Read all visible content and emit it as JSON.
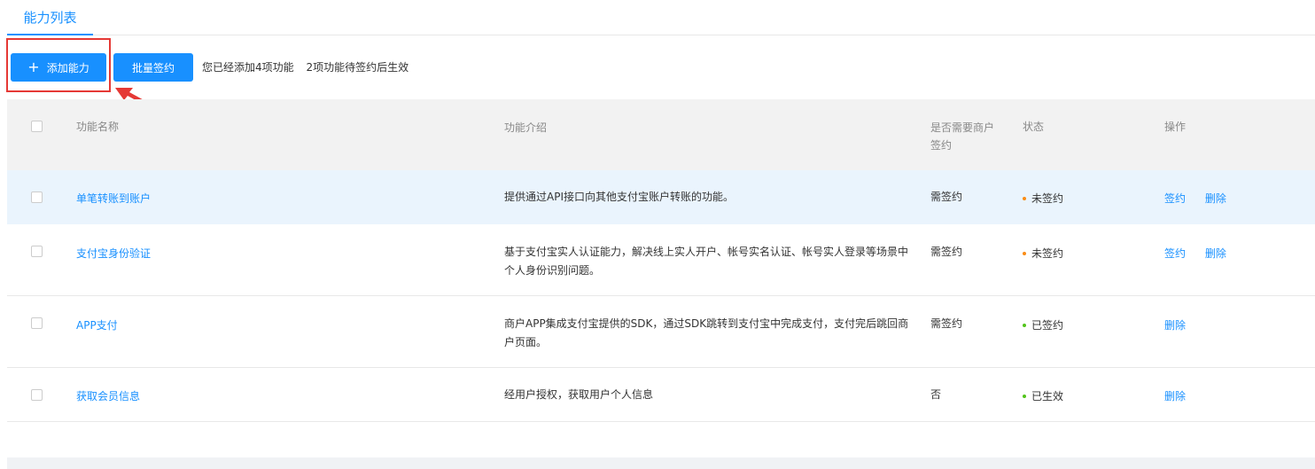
{
  "tab": {
    "label": "能力列表"
  },
  "toolbar": {
    "add_label": "添加能力",
    "add_icon": "plus-icon",
    "batch_label": "批量签约",
    "info_added": "您已经添加4项功能",
    "info_pending": "2项功能待签约后生效"
  },
  "table": {
    "headers": {
      "name": "功能名称",
      "desc": "功能介绍",
      "need_sign_line1": "是否需要商户",
      "need_sign_line2": "签约",
      "status": "状态",
      "ops": "操作"
    },
    "rows": [
      {
        "name": "单笔转账到账户",
        "desc": "提供通过API接口向其他支付宝账户转账的功能。",
        "need": "需签约",
        "status": "未签约",
        "status_color": "#fa8c16",
        "sign": "签约",
        "delete": "删除"
      },
      {
        "name": "支付宝身份验证",
        "desc": "基于支付宝实人认证能力，解决线上实人开户、帐号实名认证、帐号实人登录等场景中个人身份识别问题。",
        "need": "需签约",
        "status": "未签约",
        "status_color": "#fa8c16",
        "sign": "签约",
        "delete": "删除"
      },
      {
        "name": "APP支付",
        "desc": "商户APP集成支付宝提供的SDK，通过SDK跳转到支付宝中完成支付，支付完后跳回商户页面。",
        "need": "需签约",
        "status": "已签约",
        "status_color": "#52c41a",
        "delete": "删除"
      },
      {
        "name": "获取会员信息",
        "desc": "经用户授权，获取用户个人信息",
        "need": "否",
        "status": "已生效",
        "status_color": "#52c41a",
        "delete": "删除"
      }
    ]
  },
  "colors": {
    "accent": "#1890ff",
    "annotation": "#e53935",
    "pending": "#fa8c16",
    "done": "#52c41a"
  }
}
